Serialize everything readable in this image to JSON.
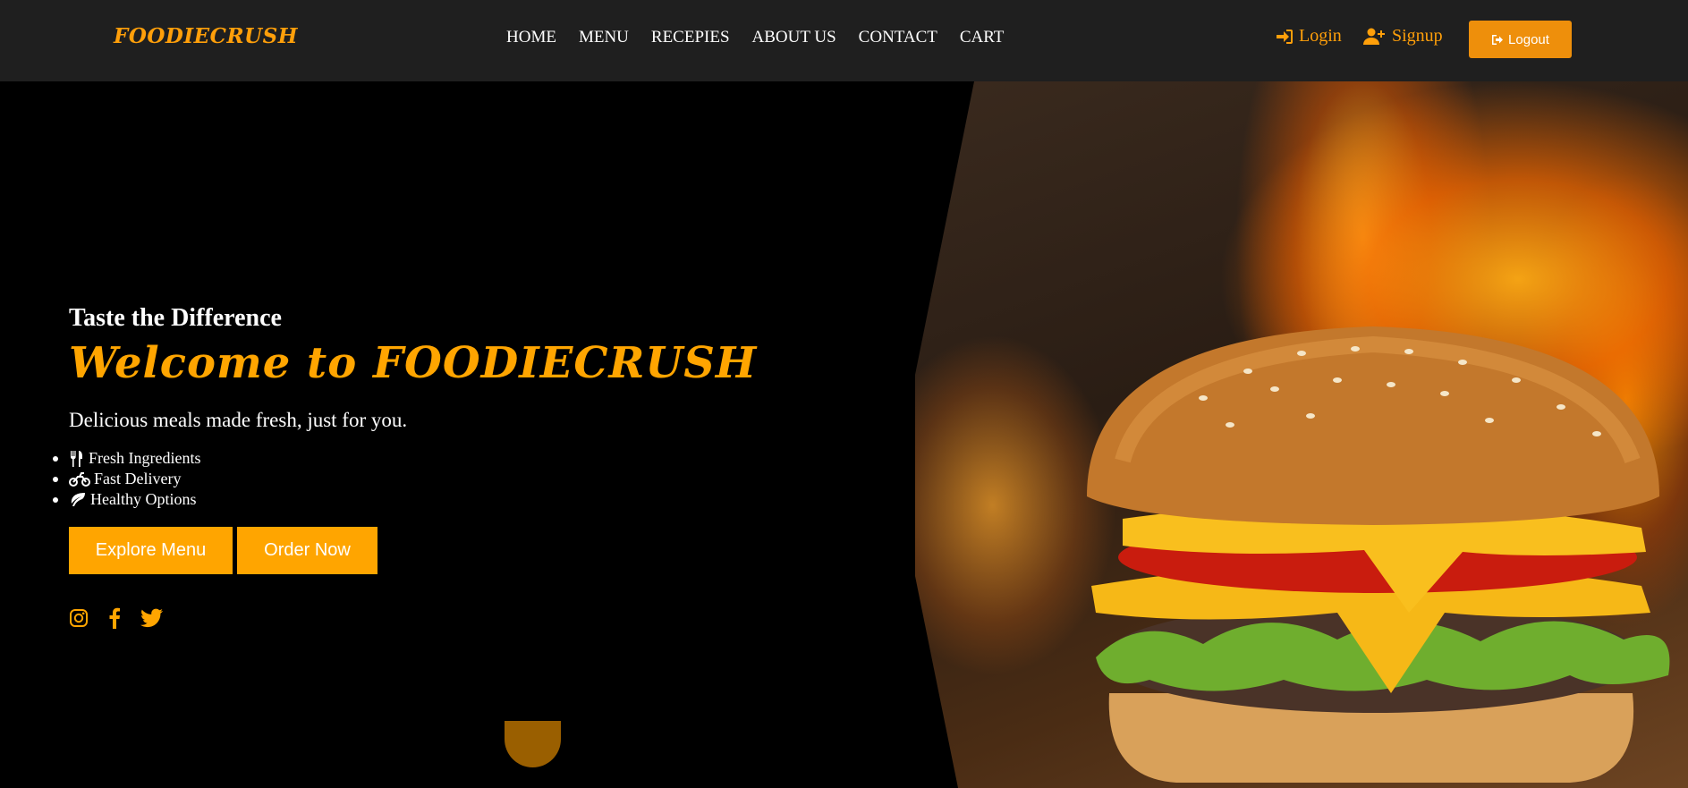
{
  "navbar": {
    "brand": "FOODIECRUSH",
    "links": [
      "HOME",
      "MENU",
      "RECEPIES",
      "ABOUT US",
      "CONTACT",
      "CART"
    ],
    "login_label": "Login",
    "signup_label": "Signup",
    "logout_label": "Logout"
  },
  "hero": {
    "tagline": "Taste the Difference",
    "welcome": "Welcome to FOODIECRUSH",
    "description": "Delicious meals made fresh, just for you.",
    "features": [
      {
        "icon": "utensils-icon",
        "label": "Fresh Ingredients"
      },
      {
        "icon": "motorcycle-icon",
        "label": "Fast Delivery"
      },
      {
        "icon": "leaf-icon",
        "label": "Healthy Options"
      }
    ],
    "explore_button": "Explore Menu",
    "order_button": "Order Now",
    "socials": [
      "instagram-icon",
      "facebook-icon",
      "twitter-icon"
    ]
  },
  "colors": {
    "accent": "#ffa500",
    "navbar_bg": "#1f1f1f",
    "logout_bg": "#ee8f0b",
    "page_bg": "#000000"
  }
}
